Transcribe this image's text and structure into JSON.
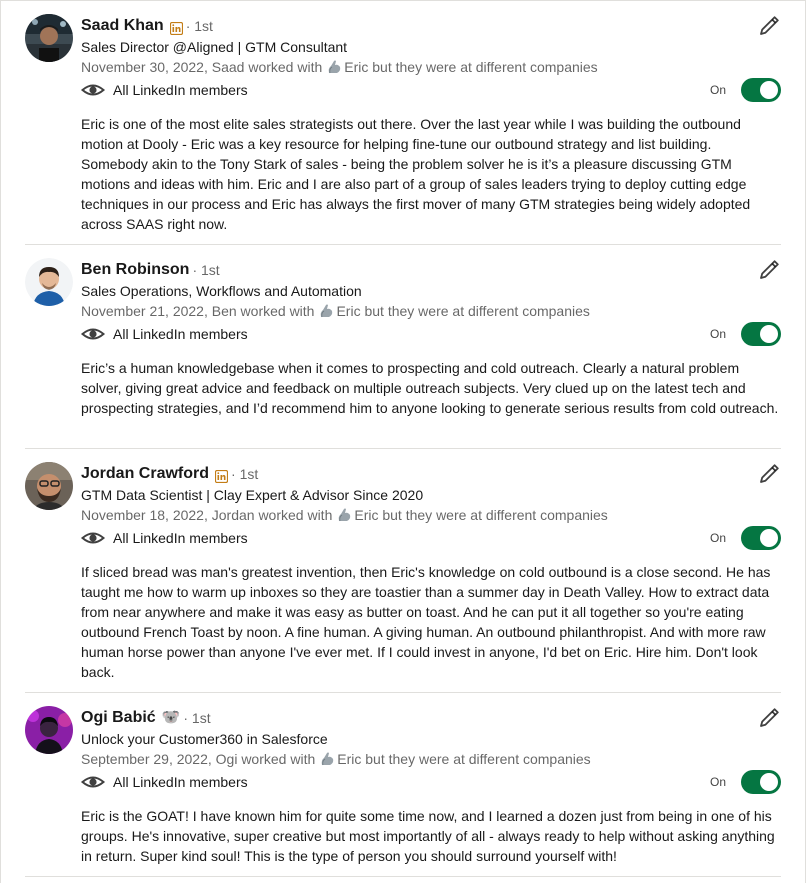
{
  "visibility_label": "All LinkedIn members",
  "toggle_label": "On",
  "worked_suffix": "Eric but they were at different companies",
  "recommendations": [
    {
      "name": "Saad Khan",
      "badge": "linkedin-premium",
      "degree": "· 1st",
      "headline": "Sales Director @Aligned | GTM Consultant",
      "date_relation": "November 30, 2022, Saad worked with",
      "text": "Eric is one of the most elite sales strategists out there. Over the last year while I was building the outbound motion at Dooly - Eric was a key resource for helping fine-tune our outbound strategy and list building. Somebody akin to the Tony Stark of sales - being the problem solver he is it’s a pleasure discussing GTM motions and ideas with him. Eric and I are also part of a group of sales leaders trying to deploy cutting edge techniques in our process and Eric has always the first mover of many GTM strategies being widely adopted across SAAS right now."
    },
    {
      "name": "Ben Robinson",
      "badge": "",
      "degree": "· 1st",
      "headline": "Sales Operations, Workflows and Automation",
      "date_relation": "November 21, 2022, Ben worked with",
      "text": "Eric’s a human knowledgebase when it comes to prospecting and cold outreach. Clearly a natural problem solver, giving great advice and feedback on multiple outreach subjects. Very clued up on the latest tech and prospecting strategies, and I’d recommend him to anyone looking to generate serious results from cold outreach."
    },
    {
      "name": "Jordan Crawford",
      "badge": "linkedin-premium",
      "degree": "· 1st",
      "headline": "GTM Data Scientist | Clay Expert & Advisor Since 2020",
      "date_relation": "November 18, 2022, Jordan worked with",
      "text": "If sliced bread was man's greatest invention, then Eric's knowledge on cold outbound is a close second. He has taught me how to warm up inboxes so they are toastier than a summer day in Death Valley. How to extract data from near anywhere and make it was easy as butter on toast. And he can put it all together so you're eating outbound French Toast by noon. A fine human. A giving human. An outbound philanthropist. And with more raw human horse power than anyone I've ever met. If I could invest in anyone, I'd bet on Eric. Hire him. Don't look back."
    },
    {
      "name": "Ogi Babić",
      "badge": "koala",
      "degree": "· 1st",
      "headline": "Unlock your Customer360 in Salesforce",
      "date_relation": "September 29, 2022, Ogi worked with",
      "text": "Eric is the GOAT! I have known him for quite some time now, and I learned a dozen just from being in one of his groups. He's innovative, super creative but most importantly of all - always ready to help without asking anything in return. Super kind soul! This is the type of person you should surround yourself with!"
    }
  ],
  "koala_emoji": "🐨",
  "colors": {
    "toggle_on": "#057642",
    "premium_badge": "#c37d16",
    "secondary_text": "rgba(0,0,0,0.6)",
    "divider": "#e0dfdc"
  }
}
